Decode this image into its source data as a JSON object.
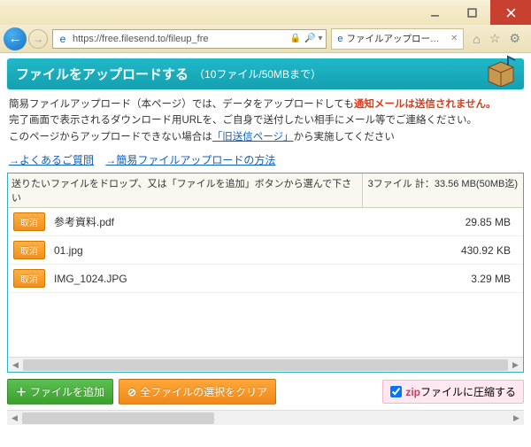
{
  "window": {
    "url": "https://free.filesend.to/fileup_fre",
    "tab_title": "ファイルアップロード｜無料大..."
  },
  "header": {
    "title": "ファイルをアップロードする",
    "subtitle": "（10ファイル/50MBまで）"
  },
  "desc": {
    "line1a": "簡易ファイルアップロード（本ページ）では、データをアップロードしても",
    "line1b": "通知メールは送信されません。",
    "line2": "完了画面で表示されるダウンロード用URLを、ご自身で送付したい相手にメール等でご連絡ください。",
    "line3a": "このページからアップロードできない場合は",
    "line3link": "「旧送信ページ」",
    "line3b": "から実施してください"
  },
  "links": {
    "faq": "→よくあるご質問",
    "howto": "→簡易ファイルアップロードの方法"
  },
  "dropzone": {
    "instruction": "送りたいファイルをドロップ、又は「ファイルを追加」ボタンから選んで下さい",
    "summary": "3ファイル 計：33.56 MB(50MB迄)",
    "cancel_label": "取消",
    "files": [
      {
        "name": "参考資料.pdf",
        "size": "29.85 MB"
      },
      {
        "name": "01.jpg",
        "size": "430.92 KB"
      },
      {
        "name": "IMG_1024.JPG",
        "size": "3.29 MB"
      }
    ]
  },
  "buttons": {
    "add": "ファイルを追加",
    "clear": "全ファイルの選択をクリア",
    "zip_label_a": "zip",
    "zip_label_b": "ファイルに圧縮する"
  }
}
